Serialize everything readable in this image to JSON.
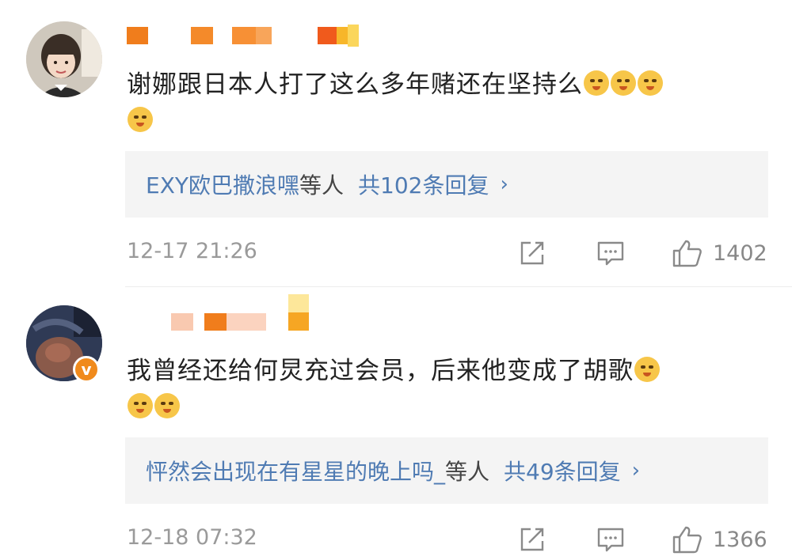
{
  "comments": [
    {
      "comment_text": "谢娜跟日本人打了这么多年赌还在坚持么",
      "emoji_name": "doge-emoji",
      "emoji_count": 4,
      "replies_who": "EXY欧巴撒浪嘿",
      "replies_mid": "等人",
      "replies_count": "共102条回复",
      "chevron": "›",
      "timestamp": "12-17 21:26",
      "likes": "1402"
    },
    {
      "comment_text": "我曾经还给何炅充过会员，后来他变成了胡歌",
      "emoji_name": "doge-emoji",
      "emoji_count": 3,
      "replies_who": "怦然会出现在有星星的晚上吗_",
      "replies_mid": "等人",
      "replies_count": "共49条回复",
      "chevron": "›",
      "timestamp": "12-18 07:32",
      "likes": "1366",
      "verified_badge": "v"
    }
  ],
  "colors": {
    "link_blue": "#4f7bb3",
    "meta_gray": "#9a9a9a",
    "reply_bg": "#f4f4f4",
    "username_orange": "#f07d1c",
    "verified_orange": "#f08a1c",
    "emoji_yellow": "#f7c649"
  },
  "icons": [
    "share-icon",
    "comment-icon",
    "like-icon",
    "doge-emoji"
  ]
}
